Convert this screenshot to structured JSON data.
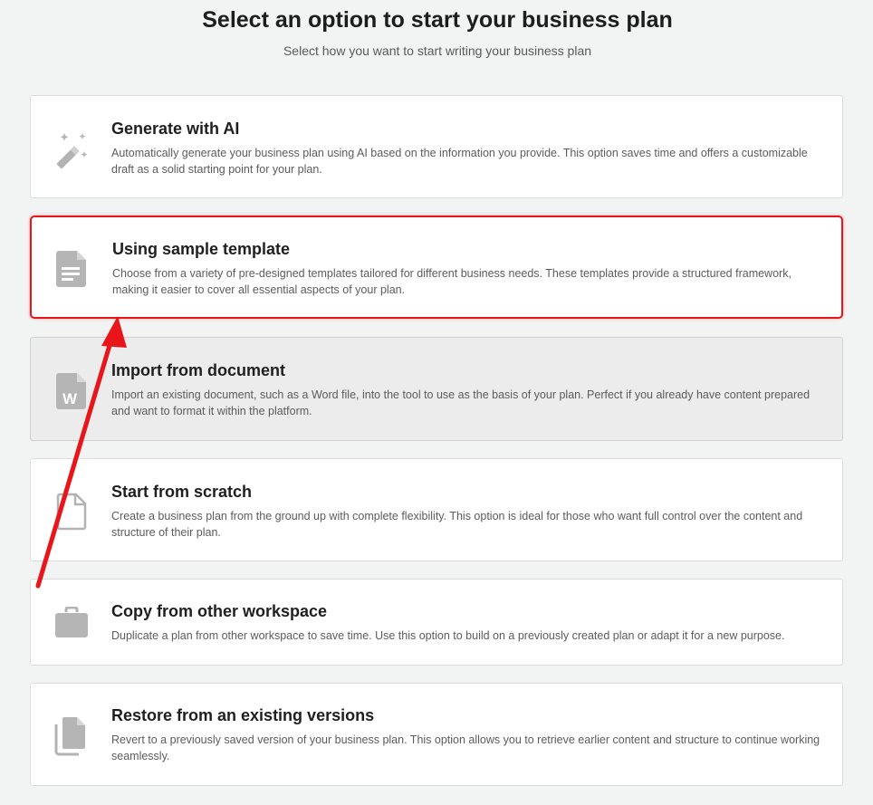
{
  "header": {
    "title": "Select an option to start your business plan",
    "subtitle": "Select how you want to start writing your business plan"
  },
  "options": [
    {
      "title": "Generate with AI",
      "description": "Automatically generate your business plan using AI based on the information you provide. This option saves time and offers a customizable draft as a solid starting point for your plan.",
      "icon": "magic-wand-icon"
    },
    {
      "title": "Using sample template",
      "description": "Choose from a variety of pre-designed templates tailored for different business needs. These templates provide a structured framework, making it easier to cover all essential aspects of your plan.",
      "icon": "document-icon"
    },
    {
      "title": "Import from document",
      "description": "Import an existing document, such as a Word file, into the tool to use as the basis of your plan. Perfect if you already have content prepared and want to format it within the platform.",
      "icon": "word-document-icon",
      "word_letter": "W"
    },
    {
      "title": "Start from scratch",
      "description": "Create a business plan from the ground up with complete flexibility. This option is ideal for those who want full control over the content and structure of their plan.",
      "icon": "blank-file-icon"
    },
    {
      "title": "Copy from other workspace",
      "description": "Duplicate a plan from other workspace to save time. Use this option to build on a previously created plan or adapt it for a new purpose.",
      "icon": "briefcase-icon"
    },
    {
      "title": "Restore from an existing versions",
      "description": "Revert to a previously saved version of your business plan. This option allows you to retrieve earlier content and structure to continue working seamlessly.",
      "icon": "copy-files-icon"
    }
  ],
  "colors": {
    "highlight": "#e8151b",
    "icon": "#b5b5b5",
    "background": "#f2f3f3"
  }
}
